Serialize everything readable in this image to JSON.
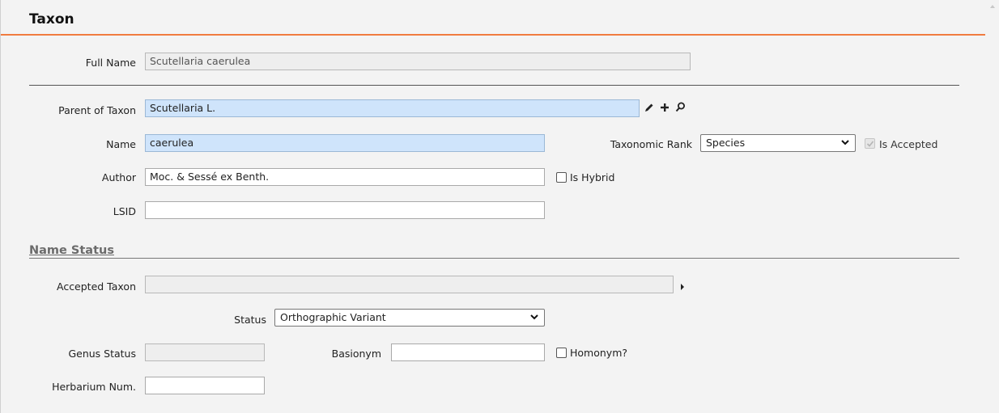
{
  "panel": {
    "title": "Taxon"
  },
  "full_name": {
    "label": "Full Name",
    "value": "Scutellaria caerulea"
  },
  "parent": {
    "label": "Parent of Taxon",
    "value": "Scutellaria L.",
    "actions": {
      "edit_icon": "pencil-icon",
      "add_icon": "plus-icon",
      "search_icon": "search-icon"
    }
  },
  "name": {
    "label": "Name",
    "value": "caerulea"
  },
  "taxonomic_rank": {
    "label": "Taxonomic Rank",
    "selected": "Species"
  },
  "is_accepted": {
    "label": "Is Accepted",
    "checked": true,
    "disabled": true
  },
  "author": {
    "label": "Author",
    "value": "Moc. & Sessé ex Benth."
  },
  "is_hybrid": {
    "label": "Is Hybrid",
    "checked": false
  },
  "lsid": {
    "label": "LSID",
    "value": ""
  },
  "name_status": {
    "title": "Name Status",
    "accepted_taxon": {
      "label": "Accepted Taxon",
      "value": "",
      "expand_icon": "caret-right-icon"
    },
    "status": {
      "label": "Status",
      "selected": "Orthographic Variant"
    },
    "genus_status": {
      "label": "Genus Status",
      "value": ""
    },
    "basionym": {
      "label": "Basionym",
      "value": ""
    },
    "homonym": {
      "label": "Homonym?",
      "checked": false
    },
    "herbarium_num": {
      "label": "Herbarium Num.",
      "value": ""
    }
  },
  "colors": {
    "accent": "#f07b3f",
    "required_field": "#cfe4fb",
    "readonly_field": "#eeeeee"
  }
}
